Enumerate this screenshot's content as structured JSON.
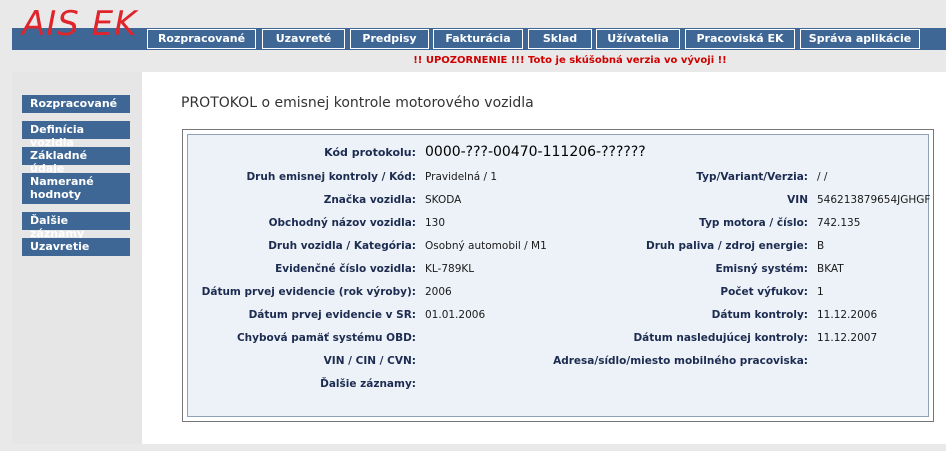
{
  "app": {
    "logo": "AIS EK"
  },
  "topnav": [
    "Rozpracované",
    "Uzavreté",
    "Predpisy",
    "Fakturácia",
    "Sklad",
    "Užívatelia",
    "Pracoviská EK",
    "Správa aplikácie"
  ],
  "warning": "!! UPOZORNENIE !!! Toto je skúšobná verzia vo vývoji !!",
  "sidenav": [
    "Rozpracované",
    "Definícia vozidla",
    "Základné údaje",
    "Namerané hodnoty",
    "Ďalšie záznamy",
    "Uzavretie"
  ],
  "title": "PROTOKOL o emisnej kontrole motorového vozidla",
  "protocol": {
    "code_label": "Kód protokolu:",
    "code_value": "0000-???-00470-111206-??????",
    "left": [
      {
        "label": "Druh emisnej kontroly / Kód:",
        "value": "Pravidelná / 1"
      },
      {
        "label": "Značka vozidla:",
        "value": "SKODA"
      },
      {
        "label": "Obchodný názov vozidla:",
        "value": "130"
      },
      {
        "label": "Druh vozidla / Kategória:",
        "value": "Osobný automobil / M1"
      },
      {
        "label": "Evidenčné číslo vozidla:",
        "value": "KL-789KL"
      },
      {
        "label": "Dátum prvej evidencie (rok výroby):",
        "value": "2006"
      },
      {
        "label": "Dátum prvej evidencie v SR:",
        "value": "01.01.2006"
      },
      {
        "label": "Chybová pamäť systému OBD:",
        "value": ""
      },
      {
        "label": "VIN / CIN / CVN:",
        "value": ""
      },
      {
        "label": "Ďalšie záznamy:",
        "value": ""
      }
    ],
    "right": [
      {
        "label": "Typ/Variant/Verzia:",
        "value": "/ /"
      },
      {
        "label": "VIN",
        "value": "546213879654JGHGF"
      },
      {
        "label": "Typ motora / číslo:",
        "value": "742.135"
      },
      {
        "label": "Druh paliva / zdroj energie:",
        "value": "B"
      },
      {
        "label": "Emisný systém:",
        "value": "BKAT"
      },
      {
        "label": "Počet výfukov:",
        "value": "1"
      },
      {
        "label": "Dátum kontroly:",
        "value": "11.12.2006"
      },
      {
        "label": "Dátum nasledujúcej kontroly:",
        "value": "11.12.2007"
      },
      {
        "label": "Adresa/sídlo/miesto mobilného pracoviska:",
        "value": ""
      }
    ]
  }
}
